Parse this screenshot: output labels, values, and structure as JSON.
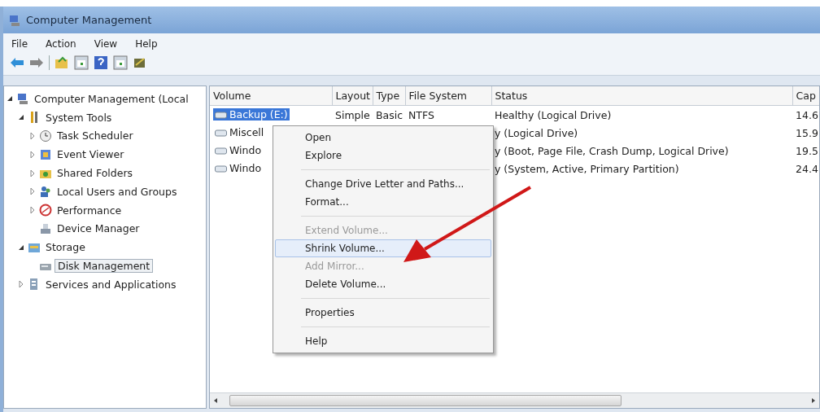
{
  "window": {
    "title": "Computer Management"
  },
  "menu_bar": [
    "File",
    "Action",
    "View",
    "Help"
  ],
  "tree": [
    {
      "label": "Computer Management (Local",
      "expanded": true,
      "selected": false,
      "children": [
        {
          "label": "System Tools",
          "expanded": true,
          "selected": false,
          "children": [
            {
              "label": "Task Scheduler",
              "expanded": false,
              "selected": false
            },
            {
              "label": "Event Viewer",
              "expanded": false,
              "selected": false
            },
            {
              "label": "Shared Folders",
              "expanded": false,
              "selected": false
            },
            {
              "label": "Local Users and Groups",
              "expanded": false,
              "selected": false
            },
            {
              "label": "Performance",
              "expanded": false,
              "selected": false
            },
            {
              "label": "Device Manager",
              "selected": false
            }
          ]
        },
        {
          "label": "Storage",
          "expanded": true,
          "selected": false,
          "children": [
            {
              "label": "Disk Management",
              "selected": true
            }
          ]
        },
        {
          "label": "Services and Applications",
          "expanded": false,
          "selected": false
        }
      ]
    }
  ],
  "table": {
    "columns": [
      "Volume",
      "Layout",
      "Type",
      "File System",
      "Status",
      "Cap"
    ],
    "rows": [
      {
        "selected": true,
        "cells": [
          "Backup (E:)",
          "Simple",
          "Basic",
          "NTFS",
          "Healthy (Logical Drive)",
          "14.6"
        ]
      },
      {
        "selected": false,
        "cells": [
          "Miscell",
          "",
          "",
          "",
          "y (Logical Drive)",
          "15.9"
        ]
      },
      {
        "selected": false,
        "cells": [
          "Windo",
          "",
          "",
          "",
          "y (Boot, Page File, Crash Dump, Logical Drive)",
          "19.5"
        ]
      },
      {
        "selected": false,
        "cells": [
          "Windo",
          "",
          "",
          "",
          "y (System, Active, Primary Partition)",
          "24.4"
        ]
      }
    ]
  },
  "context_menu": [
    {
      "kind": "item",
      "label": "Open",
      "disabled": false,
      "selected": false
    },
    {
      "kind": "item",
      "label": "Explore",
      "disabled": false,
      "selected": false
    },
    {
      "kind": "separator"
    },
    {
      "kind": "item",
      "label": "Change Drive Letter and Paths...",
      "disabled": false,
      "selected": false
    },
    {
      "kind": "item",
      "label": "Format...",
      "disabled": false,
      "selected": false
    },
    {
      "kind": "separator"
    },
    {
      "kind": "item",
      "label": "Extend Volume...",
      "disabled": true,
      "selected": false
    },
    {
      "kind": "item",
      "label": "Shrink Volume...",
      "disabled": false,
      "selected": true
    },
    {
      "kind": "item",
      "label": "Add Mirror...",
      "disabled": true,
      "selected": false
    },
    {
      "kind": "item",
      "label": "Delete Volume...",
      "disabled": false,
      "selected": false
    },
    {
      "kind": "separator"
    },
    {
      "kind": "item",
      "label": "Properties",
      "disabled": false,
      "selected": false
    },
    {
      "kind": "separator"
    },
    {
      "kind": "item",
      "label": "Help",
      "disabled": false,
      "selected": false
    }
  ]
}
